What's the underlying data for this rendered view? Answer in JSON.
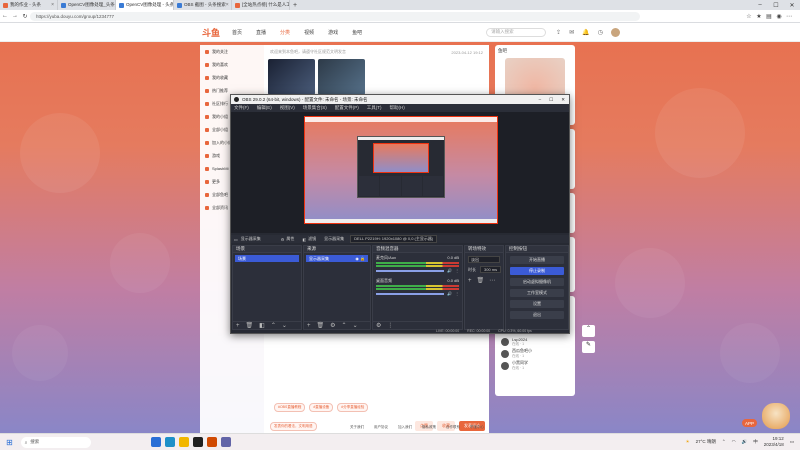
{
  "browser": {
    "tabs": [
      {
        "label": "我的作业 - 头条",
        "active": false,
        "color": "#e8663c"
      },
      {
        "label": "OpenCV图像处理_头条搜索",
        "active": false,
        "color": "#3a7bd5"
      },
      {
        "label": "OpenCV图像处理 - 头条搜索",
        "active": true,
        "color": "#3a7bd5"
      },
      {
        "label": "OBS 截图 - 头条搜索",
        "active": false,
        "color": "#3a7bd5"
      },
      {
        "label": "[全站热点榜] 什么是人工智能",
        "active": false,
        "color": "#e8663c"
      }
    ],
    "url": "https://yuba.douyu.com/group/1234777"
  },
  "site": {
    "logo": "斗鱼",
    "nav": [
      "首页",
      "直播",
      "分类",
      "视频",
      "游戏",
      "鱼吧"
    ],
    "active_nav": "分类",
    "search_placeholder": "请输入搜索",
    "left_nav": [
      "我的关注",
      "我的喜欢",
      "我的收藏",
      "热门推荐",
      "社区排行",
      "我的小组",
      "全部小组",
      "加入的小组",
      "游戏",
      "SplashMi",
      "更多",
      "全部鱼吧",
      "全部资讯"
    ],
    "post_meta": "2023-04-12 19:12",
    "post_hint": "欢迎来到本鱼吧，请遵守社区规范文明发言",
    "tags": [
      "#OBS直播教程",
      "#直播设备",
      "#分享直播经验"
    ],
    "reply_hint": "发表你的看法，文明用语",
    "actions": [
      "点赞",
      "收藏",
      "发表评论"
    ],
    "sidebar_title": "鱼吧",
    "friends": [
      {
        "name": "大黑猫人",
        "sub": "在线 · 1"
      },
      {
        "name": "Doublemine",
        "sub": "在线 · 1"
      },
      {
        "name": "Darren · 鱼吧",
        "sub": "在线 · 1"
      },
      {
        "name": "Lsp2024",
        "sub": "在线 · 1"
      },
      {
        "name": "西瓜鱼吧小",
        "sub": "在线 · 1"
      },
      {
        "name": "小黑同学",
        "sub": "在线 · 1"
      }
    ],
    "footer": [
      "关于我们",
      "用户协议",
      "加入我们",
      "隐私政策",
      "合作联系",
      "举报中心"
    ]
  },
  "obs": {
    "title": "OBS 29.0.2 (64-bit, windows) - 配置文件: 未命名 - 场景: 未命名",
    "menu": [
      "文件(F)",
      "编辑(E)",
      "视图(V)",
      "场景集合(S)",
      "配置文件(P)",
      "工具(T)",
      "帮助(H)"
    ],
    "source_bar": {
      "properties": "属性",
      "filters": "滤镜",
      "display": "显示器采集",
      "device": "DELL P2219H: 1920x1080 @ 0,0 (主显示器)"
    },
    "docks": {
      "scenes": {
        "title": "场景",
        "items": [
          "场景"
        ]
      },
      "sources": {
        "title": "来源",
        "items": [
          "显示器采集"
        ]
      },
      "mixer": {
        "title": "音频混音器",
        "channels": [
          {
            "name": "麦克风/Aux",
            "db": "0.0 dB"
          },
          {
            "name": "桌面音频",
            "db": "0.0 dB"
          }
        ]
      },
      "transitions": {
        "title": "转场特效",
        "type": "淡出",
        "duration_label": "时长",
        "duration": "300 ms"
      },
      "controls": {
        "title": "控制按钮",
        "buttons": [
          "开始直播",
          "停止录制",
          "启动虚拟摄像机",
          "工作室模式",
          "设置",
          "退出"
        ]
      }
    },
    "status": {
      "live": "LIVE: 00:00:00",
      "rec": "REC: 00:00:00",
      "cpu": "CPU: 0.3%, 60.00 fps"
    }
  },
  "taskbar": {
    "search": "搜索",
    "weather": "27°C 晴朗",
    "ime": "中",
    "time": "19:12",
    "date": "2023/4/18"
  },
  "overlay": {
    "chat_label": "APP"
  },
  "colors": {
    "accent": "#e8663c",
    "obs_blue": "#3b5bd6",
    "obs_bg": "#272a33"
  }
}
